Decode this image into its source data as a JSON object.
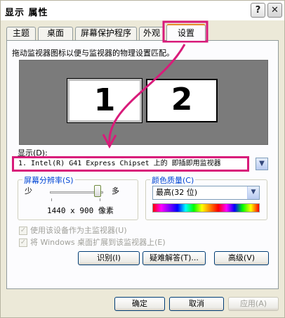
{
  "window": {
    "title": "显示 属性",
    "help_glyph": "?",
    "close_glyph": "✕"
  },
  "tabs": [
    {
      "label": "主题"
    },
    {
      "label": "桌面"
    },
    {
      "label": "屏幕保护程序"
    },
    {
      "label": "外观"
    },
    {
      "label": "设置",
      "active": true
    }
  ],
  "settings": {
    "hint": "拖动监视器图标以便与监视器的物理设置匹配。",
    "monitors": [
      "1",
      "2"
    ],
    "display_label": "显示(D):",
    "display_value": "1. Intel(R) G41 Express Chipset 上的 即插即用监视器",
    "resolution": {
      "group_label": "屏幕分辨率(S)",
      "less": "少",
      "more": "多",
      "value": "1440 x 900 像素",
      "slider_level": 0.9
    },
    "color": {
      "group_label": "颜色质量(C)",
      "value": "最高(32 位)"
    },
    "checks": [
      {
        "label": "使用该设备作为主监视器(U)",
        "checked": true
      },
      {
        "label": "将 Windows 桌面扩展到该监视器上(E)",
        "checked": true
      }
    ],
    "buttons": {
      "identify": "识别(I)",
      "troubleshoot": "疑难解答(T)...",
      "advanced": "高级(V)"
    }
  },
  "footer": {
    "ok": "确定",
    "cancel": "取消",
    "apply": "应用(A)"
  },
  "colors": {
    "annotation": "#d81b7a",
    "active_tab_accent": "#e68b2c"
  }
}
